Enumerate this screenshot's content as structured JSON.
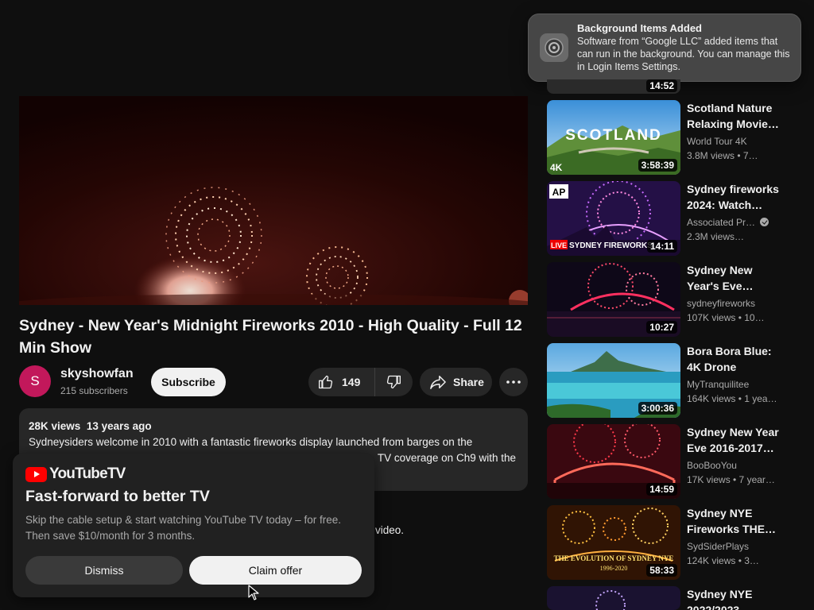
{
  "video": {
    "title": "Sydney - New Year's Midnight Fireworks 2010 - High Quality - Full 12 Min Show",
    "channel": "skyshowfan",
    "subscribers": "215 subscribers",
    "avatar_letter": "S",
    "subscribe_label": "Subscribe",
    "likes": "149",
    "share_label": "Share",
    "views": "28K views",
    "age": "13 years ago",
    "desc_line1": "Sydneysiders welcome in 2010 with a fantastic fireworks display launched from barges on the",
    "desc_line2": "TV coverage on Ch9 with the",
    "below_text": "video."
  },
  "promo": {
    "logo_text": "YouTubeTV",
    "heading": "Fast-forward to better TV",
    "body": "Skip the cable setup & start watching YouTube TV today – for free. Then save $10/month for 3 months.",
    "dismiss_label": "Dismiss",
    "claim_label": "Claim offer"
  },
  "notification": {
    "title": "Background Items Added",
    "body": "Software from “Google LLC” added items that can run in the background. You can manage this in Login Items Settings."
  },
  "sidebar": {
    "partial_duration": "14:52",
    "items": [
      {
        "title": "Scotland Nature Relaxing Movie…",
        "channel": "World Tour 4K",
        "meta": "3.8M views  • 7…",
        "duration": "3:58:39",
        "verified": false,
        "thumb_text": "SCOTLAND",
        "badge": "4K"
      },
      {
        "title": "Sydney fireworks 2024: Watch…",
        "channel": "Associated Pr…",
        "meta": "2.3M views…",
        "duration": "14:11",
        "verified": true,
        "thumb_text": "SYDNEY FIREWORKS",
        "badge": "AP",
        "live_label": "LIVE"
      },
      {
        "title": "Sydney New Year's Eve…",
        "channel": "sydneyfireworks",
        "meta": "107K views  • 10…",
        "duration": "10:27",
        "verified": false
      },
      {
        "title": "Bora Bora Blue: 4K Drone Foota…",
        "channel": "MyTranquilitee",
        "meta": "164K views  • 1 yea…",
        "duration": "3:00:36",
        "verified": false
      },
      {
        "title": "Sydney New Year Eve 2016-2017…",
        "channel": "BooBooYou",
        "meta": "17K views  • 7 year…",
        "duration": "14:59",
        "verified": false
      },
      {
        "title": "Sydney NYE Fireworks THE…",
        "channel": "SydSiderPlays",
        "meta": "124K views  • 3…",
        "duration": "58:33",
        "verified": false,
        "thumb_text": "THE EVOLUTION OF SYDNEY NYE",
        "thumb_sub": "1996-2020"
      },
      {
        "title": "Sydney NYE 2022/2023…",
        "channel": "",
        "meta": "",
        "duration": "",
        "verified": false
      }
    ]
  }
}
